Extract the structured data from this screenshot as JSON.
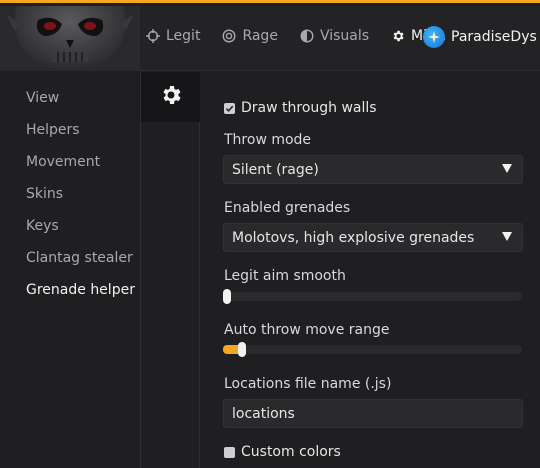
{
  "header": {
    "tabs": [
      {
        "label": "Legit",
        "icon": "crosshair-icon"
      },
      {
        "label": "Rage",
        "icon": "target-icon"
      },
      {
        "label": "Visuals",
        "icon": "half-circle-icon"
      },
      {
        "label": "Misc.",
        "icon": "gear-icon"
      }
    ],
    "active_tab": "Misc.",
    "username": "ParadiseDys"
  },
  "sidebar": {
    "items": [
      {
        "label": "View"
      },
      {
        "label": "Helpers"
      },
      {
        "label": "Movement"
      },
      {
        "label": "Skins"
      },
      {
        "label": "Keys"
      },
      {
        "label": "Clantag stealer"
      },
      {
        "label": "Grenade helper"
      }
    ],
    "active": "Grenade helper"
  },
  "content": {
    "draw_through_walls": {
      "label": "Draw through walls",
      "checked": true
    },
    "throw_mode": {
      "label": "Throw mode",
      "value": "Silent (rage)"
    },
    "enabled_grenades": {
      "label": "Enabled grenades",
      "value": "Molotovs, high explosive grenades"
    },
    "legit_aim_smooth": {
      "label": "Legit aim smooth",
      "value": 0.0
    },
    "auto_throw_move_range": {
      "label": "Auto throw move range",
      "value": 0.05
    },
    "locations_file": {
      "label": "Locations file name (.js)",
      "value": "locations"
    },
    "custom_colors": {
      "label": "Custom colors",
      "checked": false
    }
  },
  "colors": {
    "accent": "#f5a623",
    "background": "#1f1f21",
    "header": "#232325",
    "field": "#2a2a2c"
  }
}
